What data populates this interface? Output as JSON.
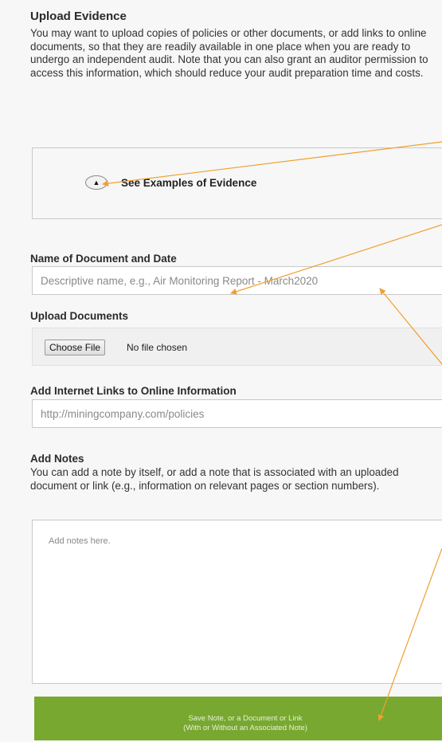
{
  "upload_evidence": {
    "title": "Upload Evidence",
    "description": "You may want to upload copies of policies or other documents, or add links to online documents, so that they are readily available in one place when you are ready to undergo an independent audit. Note that you can also grant an auditor permission to access this information, which should reduce your audit preparation time and costs."
  },
  "examples": {
    "toggle_icon": "chevron-up-icon",
    "label": "See Examples of Evidence"
  },
  "document_name": {
    "label": "Name of Document and Date",
    "placeholder": "Descriptive name, e.g., Air Monitoring Report - March2020",
    "value": ""
  },
  "upload_documents": {
    "label": "Upload Documents",
    "button_label": "Choose File",
    "status": "No file chosen"
  },
  "internet_links": {
    "label": "Add Internet Links to Online Information",
    "placeholder": "http://miningcompany.com/policies",
    "value": ""
  },
  "notes": {
    "label": "Add Notes",
    "help": "You can add a note by itself, or add a note that is associated with an uploaded document or link (e.g., information on relevant pages or section numbers).",
    "placeholder": "Add notes here."
  },
  "save_button": {
    "line1": "Save Note, or a Document or Link",
    "line2": "(With or Without an Associated Note)"
  },
  "colors": {
    "accent_green": "#78a830",
    "annotation_arrow": "#f0a030"
  }
}
